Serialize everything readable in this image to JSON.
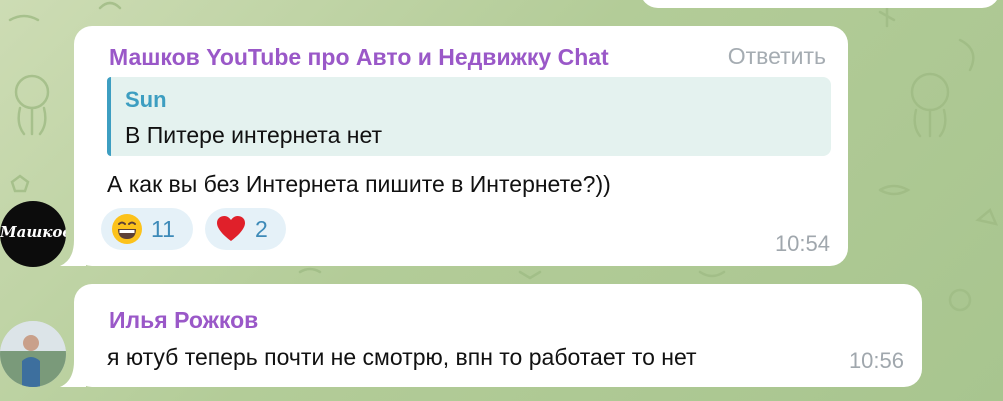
{
  "messages": [
    {
      "author": "Машков YouTube про Авто и Недвижку Chat",
      "reply_label": "Ответить",
      "quote": {
        "author": "Sun",
        "text": "В Питере интернета нет"
      },
      "text": "А как вы без Интернета пишите в Интернете?))",
      "reactions": [
        {
          "emoji": "grinning-face-icon",
          "count": "11"
        },
        {
          "emoji": "red-heart-icon",
          "count": "2"
        }
      ],
      "time": "10:54",
      "avatar_text": "Машков"
    },
    {
      "author": "Илья Рожков",
      "text": "я ютуб теперь почти не смотрю, впн то работает то нет",
      "time": "10:56"
    }
  ],
  "colors": {
    "author": "#9a58c8",
    "quote_accent": "#3d9ec1",
    "reaction_bg": "#e5f1f8",
    "reaction_count": "#3d8ab8",
    "background": "#b3cc98",
    "time": "#a0a7ad"
  }
}
